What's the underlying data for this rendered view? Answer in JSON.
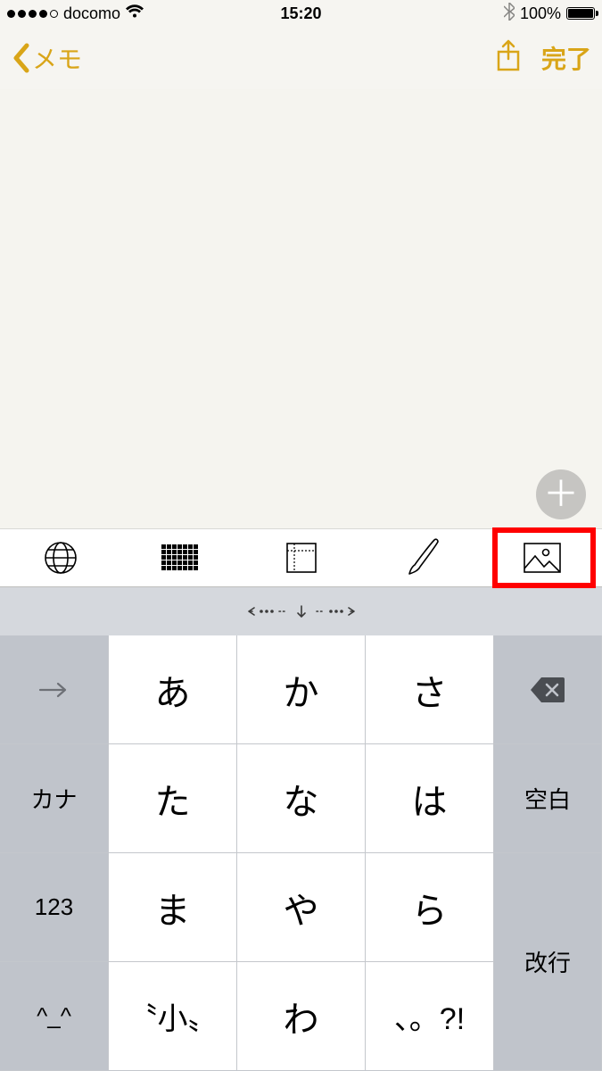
{
  "status": {
    "carrier": "docomo",
    "time": "15:20",
    "battery_pct": "100%"
  },
  "nav": {
    "back_label": "メモ",
    "done_label": "完了"
  },
  "toolbar": {
    "items": [
      "globe-icon",
      "grid-icon",
      "paper-icon",
      "brush-icon",
      "image-icon"
    ],
    "highlighted_index": 4
  },
  "keyboard": {
    "handle_glyph": "⟨⋯ ⋯ ↓ ⋯ ⋯⟩",
    "left_col": [
      "→",
      "カナ",
      "123",
      "^_^"
    ],
    "kana_rows": [
      [
        "あ",
        "か",
        "さ"
      ],
      [
        "た",
        "な",
        "は"
      ],
      [
        "ま",
        "や",
        "ら"
      ],
      [
        "〝小〟",
        "わ",
        "、。?!"
      ]
    ],
    "right_col": {
      "backspace": "⌫",
      "space_label": "空白",
      "return_label": "改行"
    }
  }
}
